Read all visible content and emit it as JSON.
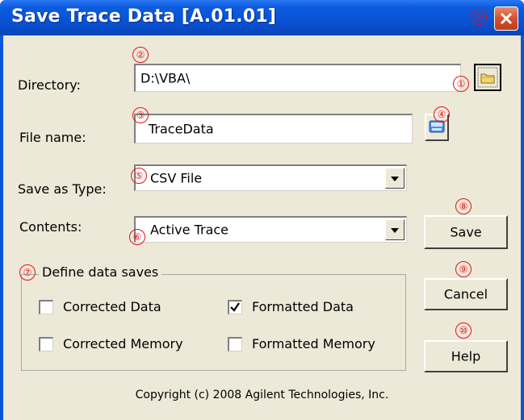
{
  "window": {
    "title": "Save Trace Data [A.01.01]",
    "colors": {
      "titlebar": "#0a56d8",
      "close": "#d4502b",
      "face": "#ece9d8",
      "marker": "#e8101a"
    }
  },
  "fields": {
    "directory_label": "Directory:",
    "directory_value": "D:\\VBA\\",
    "filename_label": "File name:",
    "filename_value": "TraceData",
    "save_as_type_label": "Save as Type:",
    "save_as_type_value": "CSV File",
    "contents_label": "Contents:",
    "contents_value": "Active Trace"
  },
  "group": {
    "title": "Define data saves",
    "checkboxes": [
      {
        "label": "Corrected Data",
        "checked": false
      },
      {
        "label": "Formatted Data",
        "checked": true
      },
      {
        "label": "Corrected Memory",
        "checked": false
      },
      {
        "label": "Formatted Memory",
        "checked": false
      }
    ]
  },
  "buttons": {
    "save": "Save",
    "cancel": "Cancel",
    "help": "Help"
  },
  "icons": {
    "browse": "folder-icon",
    "keyboard": "keyboard-icon",
    "close": "close-icon"
  },
  "markers": [
    "①",
    "②",
    "③",
    "④",
    "⑤",
    "⑥",
    "⑦",
    "⑧",
    "⑨",
    "⑩",
    "⑨"
  ],
  "footer": {
    "copyright": "Copyright (c) 2008 Agilent Technologies, Inc."
  }
}
